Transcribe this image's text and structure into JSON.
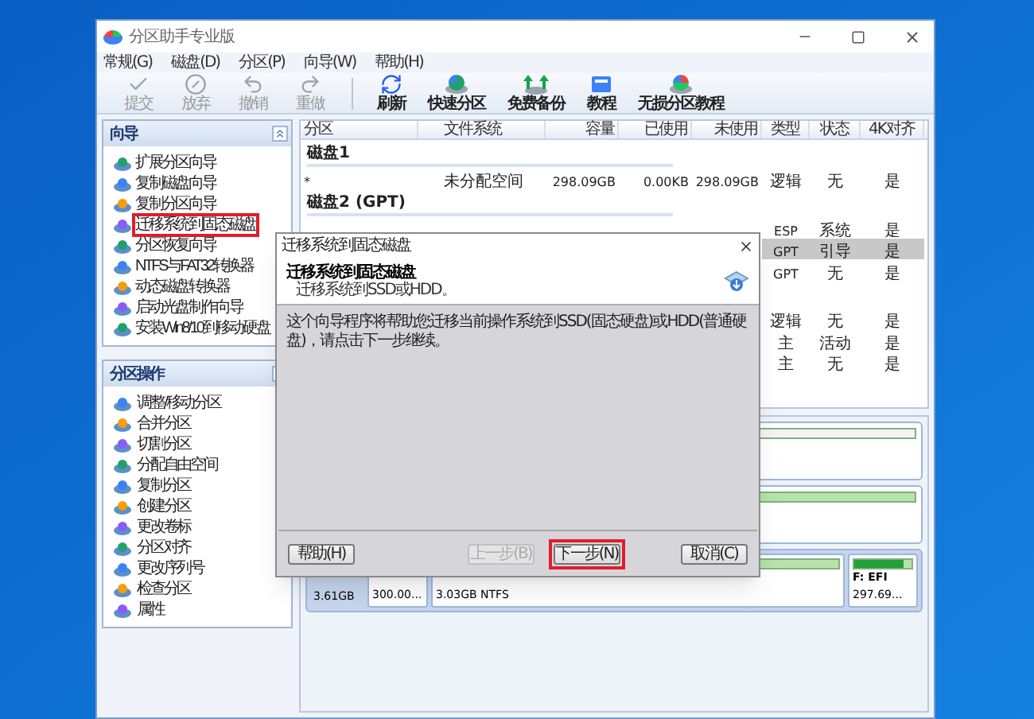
{
  "window": {
    "title": "分区助手专业版"
  },
  "menu": [
    "常规(G)",
    "磁盘(D)",
    "分区(P)",
    "向导(W)",
    "帮助(H)"
  ],
  "toolbar": [
    {
      "kind": "apply",
      "label": "提交",
      "disabled": true
    },
    {
      "kind": "discard",
      "label": "放弃",
      "disabled": true
    },
    {
      "kind": "undo",
      "label": "撤销",
      "disabled": true
    },
    {
      "kind": "redo",
      "label": "重做",
      "disabled": true
    },
    {
      "kind": "refresh",
      "label": "刷新",
      "disabled": false
    },
    {
      "kind": "quick",
      "label": "快速分区",
      "disabled": false
    },
    {
      "kind": "backup",
      "label": "免费备份",
      "disabled": false
    },
    {
      "kind": "tutorial",
      "label": "教程",
      "disabled": false
    },
    {
      "kind": "lossless",
      "label": "无损分区教程",
      "disabled": false
    }
  ],
  "wizard_panel": {
    "title": "向导",
    "items": [
      {
        "label": "扩展分区向导",
        "highlighted": false
      },
      {
        "label": "复制磁盘向导",
        "highlighted": false
      },
      {
        "label": "复制分区向导",
        "highlighted": false
      },
      {
        "label": "迁移系统到固态磁盘",
        "highlighted": true
      },
      {
        "label": "分区恢复向导",
        "highlighted": false
      },
      {
        "label": "NTFS与FAT32转换器",
        "highlighted": false
      },
      {
        "label": "动态磁盘转换器",
        "highlighted": false
      },
      {
        "label": "启动光盘制作向导",
        "highlighted": false
      },
      {
        "label": "安装Win8/10到移动硬盘",
        "highlighted": false
      }
    ]
  },
  "operations_panel": {
    "title": "分区操作",
    "items": [
      "调整/移动分区",
      "合并分区",
      "切割分区",
      "分配自由空间",
      "复制分区",
      "创建分区",
      "更改卷标",
      "分区对齐",
      "更改序列号",
      "检查分区",
      "属性"
    ]
  },
  "table": {
    "columns": [
      "分区",
      "文件系统",
      "容量",
      "已使用",
      "未使用",
      "类型",
      "状态",
      "4K对齐"
    ],
    "disks": [
      {
        "title": "磁盘1",
        "rows": [
          {
            "partition": "*",
            "filesystem": "未分配空间",
            "capacity": "298.09GB",
            "used": "0.00KB",
            "free": "298.09GB",
            "type": "逻辑",
            "status": "无",
            "align": "是",
            "selected": false
          }
        ]
      },
      {
        "title": "磁盘2 (GPT)",
        "rows": [
          {
            "type": "ESP",
            "status": "系统",
            "align": "是",
            "selected": false
          },
          {
            "type": "GPT",
            "status": "引导",
            "align": "是",
            "selected": true
          },
          {
            "type": "GPT",
            "status": "无",
            "align": "是",
            "selected": false
          }
        ]
      },
      {
        "rows": [
          {
            "type": "逻辑",
            "status": "无",
            "align": "是",
            "selected": false
          },
          {
            "type": "主",
            "status": "活动",
            "align": "是",
            "selected": false
          },
          {
            "type": "主",
            "status": "无",
            "align": "是",
            "selected": false
          }
        ]
      }
    ]
  },
  "disk_map": {
    "disk_size": "3.61GB",
    "partitions": [
      {
        "text": "300.00..."
      },
      {
        "text": "3.03GB NTFS"
      },
      {
        "name": "F: EFI",
        "text": "297.69..."
      }
    ]
  },
  "dialog": {
    "title": "迁移系统到固态磁盘",
    "heading": "迁移系统到固态磁盘",
    "subheading": "迁移系统到SSD或HDD。",
    "message": "这个向导程序将帮助您迁移当前操作系统到SSD(固态硬盘)或HDD(普通硬盘)，请点击下一步继续。",
    "buttons": [
      {
        "kind": "help",
        "label": "帮助(H)",
        "disabled": false,
        "highlighted": false
      },
      {
        "kind": "back",
        "label": "上一步(B)",
        "disabled": true,
        "highlighted": false
      },
      {
        "kind": "next",
        "label": "下一步(N)",
        "disabled": false,
        "highlighted": true
      },
      {
        "kind": "cancel",
        "label": "取消(C)",
        "disabled": false,
        "highlighted": false
      }
    ]
  }
}
